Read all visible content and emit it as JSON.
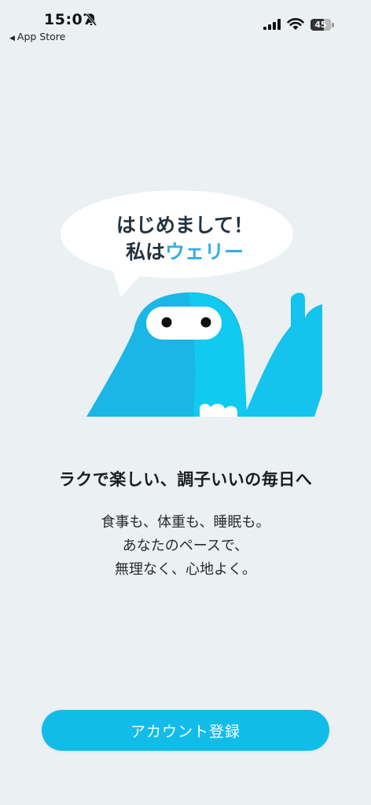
{
  "status_bar": {
    "time": "15:07",
    "back_label": "App Store",
    "battery": "45"
  },
  "hero": {
    "greeting_line1": "はじめまして！",
    "greeting_line2_prefix": "私は",
    "greeting_name": "ウェリー",
    "accent_color": "#35aee4",
    "mascot_color": "#14c3ee"
  },
  "content": {
    "headline": "ラクで楽しい、調子いいの毎日へ",
    "description_lines": [
      "食事も、体重も、睡眠も。",
      "あなたのペースで、",
      "無理なく、心地よく。"
    ]
  },
  "actions": {
    "register_label": "アカウント登録",
    "button_color": "#12bce9"
  }
}
